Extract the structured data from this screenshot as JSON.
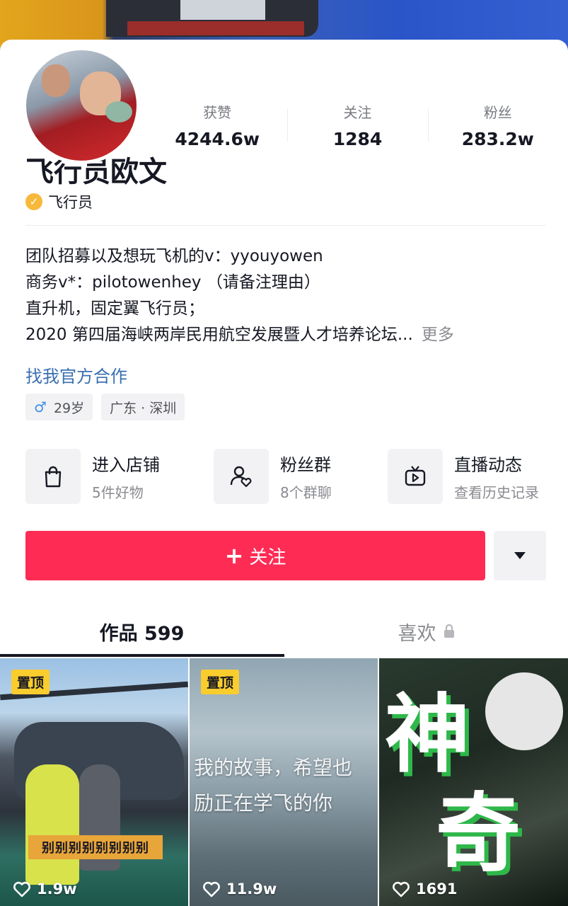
{
  "profile": {
    "name": "飞行员欧文",
    "verify_label": "飞行员"
  },
  "stats": [
    {
      "label": "获赞",
      "value": "4244.6w"
    },
    {
      "label": "关注",
      "value": "1284"
    },
    {
      "label": "粉丝",
      "value": "283.2w"
    }
  ],
  "bio": {
    "lines": [
      "团队招募以及想玩飞机的v：yyouyowen",
      "商务v*：pilotowenhey （请备注理由）",
      "直升机，固定翼飞行员；",
      "2020 第四届海峡两岸民用航空发展暨人才培养论坛..."
    ],
    "more_label": "更多",
    "official_link": "找我官方合作"
  },
  "tags": {
    "gender_symbol": "♂",
    "age": "29岁",
    "location": "广东 · 深圳"
  },
  "entries": [
    {
      "title": "进入店铺",
      "subtitle": "5件好物",
      "icon": "shopping-bag-icon"
    },
    {
      "title": "粉丝群",
      "subtitle": "8个群聊",
      "icon": "fan-group-icon"
    },
    {
      "title": "直播动态",
      "subtitle": "查看历史记录",
      "icon": "live-tv-icon"
    }
  ],
  "follow": {
    "plus": "+",
    "label": "关注"
  },
  "tabs": {
    "works": "作品 599",
    "likes": "喜欢"
  },
  "videos": [
    {
      "pinned_label": "置顶",
      "likes": "1.9w",
      "caption": "别别别别别别别别"
    },
    {
      "pinned_label": "置顶",
      "likes": "11.9w",
      "overlay_lines": [
        "我的故事，希望也",
        "励正在学飞的你"
      ]
    },
    {
      "likes": "1691",
      "overlay_chars": [
        "神",
        "奇"
      ]
    }
  ],
  "colors": {
    "accent": "#fe2c55",
    "link": "#3a6fb0",
    "pin": "#facd2e",
    "verify": "#f6b93b"
  }
}
